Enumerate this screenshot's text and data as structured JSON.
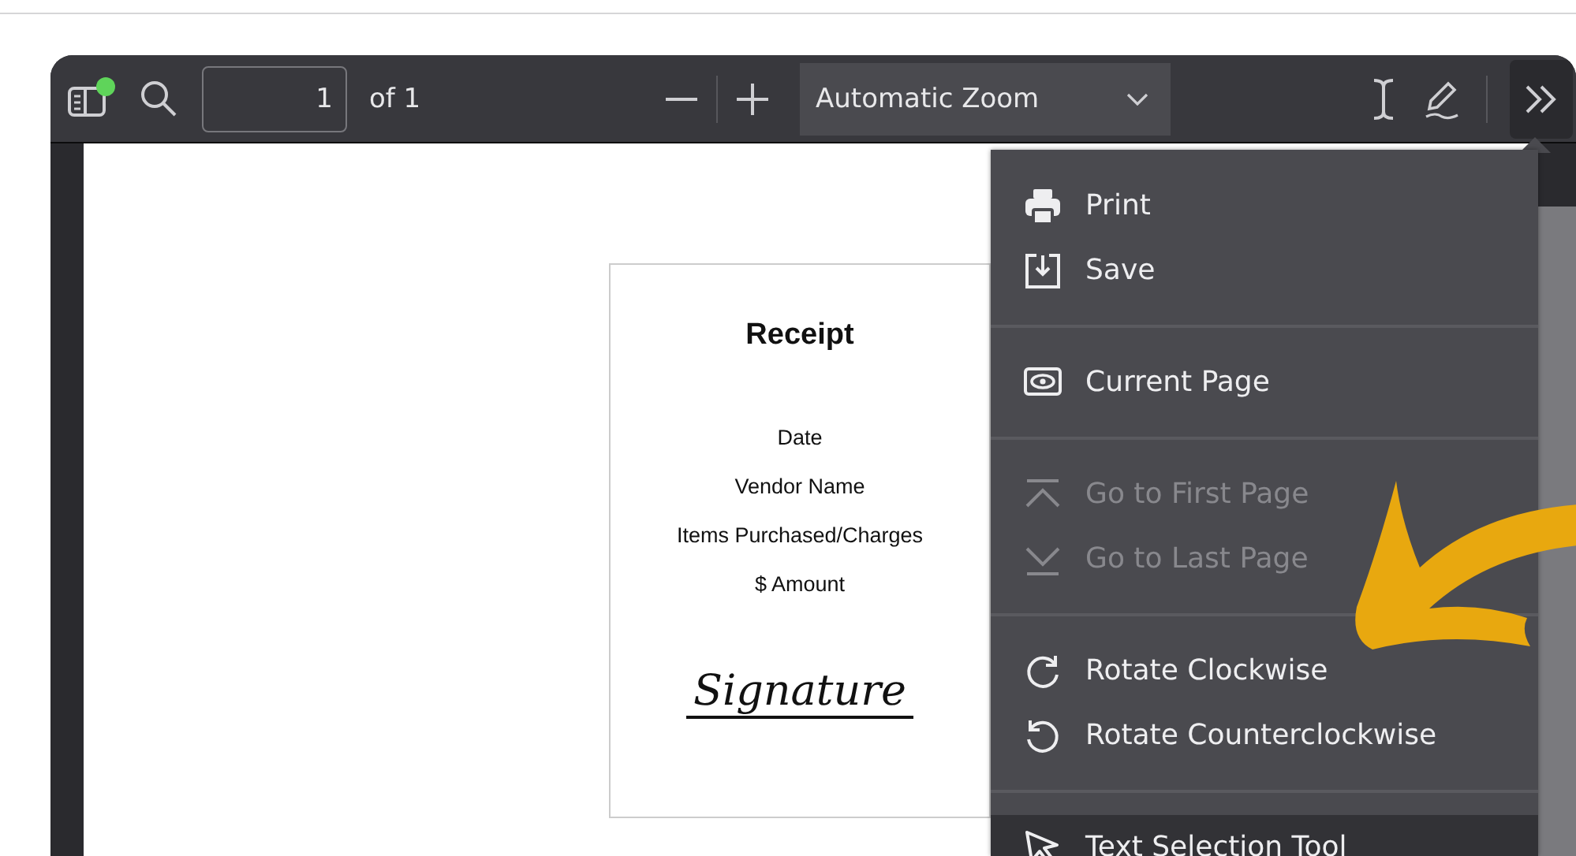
{
  "toolbar": {
    "page_number": "1",
    "page_count": "of 1",
    "zoom": "Automatic Zoom",
    "tools_open": true
  },
  "document": {
    "title": "Receipt",
    "lines": [
      "Date",
      "Vendor Name",
      "Items Purchased/Charges",
      "$ Amount"
    ],
    "signature": "Signature"
  },
  "menu": {
    "groups": [
      {
        "items": [
          {
            "label": "Print",
            "disabled": false,
            "selected": false
          },
          {
            "label": "Save",
            "disabled": false,
            "selected": false
          }
        ]
      },
      {
        "items": [
          {
            "label": "Current Page",
            "disabled": false,
            "selected": false
          }
        ]
      },
      {
        "items": [
          {
            "label": "Go to First Page",
            "disabled": true,
            "selected": false
          },
          {
            "label": "Go to Last Page",
            "disabled": true,
            "selected": false
          }
        ]
      },
      {
        "items": [
          {
            "label": "Rotate Clockwise",
            "disabled": false,
            "selected": false
          },
          {
            "label": "Rotate Counterclockwise",
            "disabled": false,
            "selected": false
          }
        ]
      },
      {
        "items": [
          {
            "label": "Text Selection Tool",
            "disabled": false,
            "selected": true
          }
        ]
      }
    ]
  }
}
